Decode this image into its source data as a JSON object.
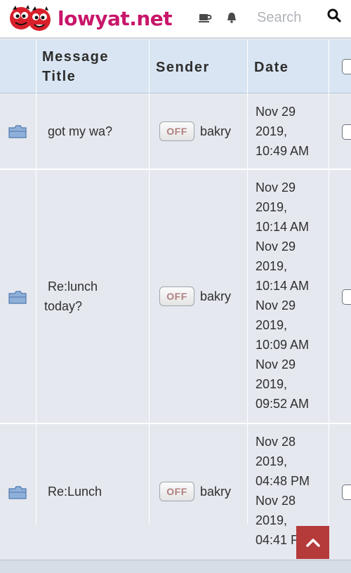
{
  "brand": {
    "name": "lowyat.net"
  },
  "search": {
    "placeholder": "Search"
  },
  "table": {
    "headers": {
      "title": "Message Title",
      "title_line1": "Message",
      "title_line2": "Title",
      "sender": "Sender",
      "date": "Date"
    },
    "rows": [
      {
        "title_line1": "got my wa?",
        "title_line2": "",
        "status": "OFF",
        "sender": "bakry",
        "date_lines": [
          "Nov 29",
          "2019,",
          "10:49 AM"
        ]
      },
      {
        "title_line1": "Re:lunch",
        "title_line2": "today?",
        "status": "OFF",
        "sender": "bakry",
        "date_lines": [
          "Nov 29",
          "2019,",
          "10:14 AM",
          "Nov 29",
          "2019,",
          "10:14 AM",
          "Nov 29",
          "2019,",
          "10:09 AM",
          "Nov 29",
          "2019,",
          "09:52 AM"
        ]
      },
      {
        "title_line1": "Re:Lunch",
        "title_line2": "",
        "status": "OFF",
        "sender": "bakry",
        "date_lines": [
          "Nov 28",
          "2019,",
          "04:48 PM",
          "Nov 28",
          "2019,",
          "04:41 PM"
        ]
      }
    ]
  },
  "colors": {
    "brand": "#c8166a",
    "header_bg": "#d9e5f2",
    "row_bg": "#e5e8ef",
    "back_to_top": "#b53a3a"
  },
  "icons": [
    "coffee-icon",
    "bell-icon",
    "search-icon",
    "folder-icon",
    "chevron-up-icon",
    "mascot-logo"
  ]
}
